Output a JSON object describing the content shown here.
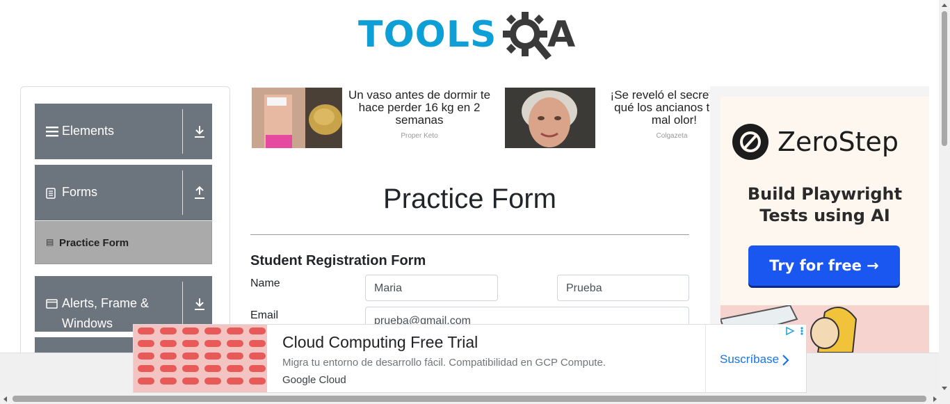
{
  "header": {
    "logo_text_tools": "TOOLS",
    "logo_text_a": "A",
    "logo_accent": "#0e9fd6"
  },
  "sidebar": {
    "groups": [
      {
        "label": "Elements",
        "icon": "hamburger-icon",
        "arrow": "download-arrow-icon"
      },
      {
        "label": "Forms",
        "icon": "document-icon",
        "arrow": "upload-arrow-icon"
      },
      {
        "label": "Alerts, Frame & Windows",
        "label_line1": "Alerts, Frame &",
        "label_line2": "Windows",
        "icon": "window-icon",
        "arrow": "download-arrow-icon"
      }
    ],
    "active_item": "Practice Form"
  },
  "top_ads": [
    {
      "text": "Un vaso antes de dormir te hace perder 16 kg en 2 semanas",
      "source": "Proper Keto"
    },
    {
      "text": "¡Se reveló el secreto de por qué los ancianos tienen mal olor!",
      "text_visible": "¡Se reveló el secret qué los ancianos ti mal olor!",
      "source": "Colgazeta"
    }
  ],
  "form": {
    "title": "Practice Form",
    "subtitle": "Student Registration Form",
    "name_label": "Name",
    "first_name": "Maria",
    "last_name": "Prueba",
    "email_label": "Email",
    "email": "prueba@gmail.com"
  },
  "right_ad": {
    "brand": "ZeroStep",
    "headline_line1": "Build Playwright",
    "headline_line2": "Tests using AI",
    "cta": "Try for free →",
    "cta_color": "#1a56f0"
  },
  "bottom_ad": {
    "title": "Cloud Computing Free Trial",
    "description": "Migra tu entorno de desarrollo fácil. Compatibilidad en GCP Compute.",
    "advertiser": "Google Cloud",
    "cta": "Suscríbase",
    "cta_color": "#1a73e8"
  }
}
